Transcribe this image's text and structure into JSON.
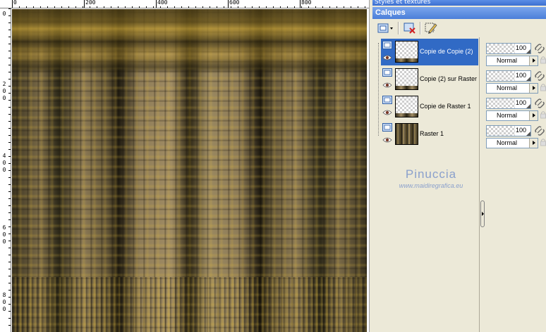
{
  "panel": {
    "styles_title": "Styles et textures",
    "layers_title": "Calques"
  },
  "ruler": {
    "top_labels": [
      "0",
      "200",
      "400",
      "600",
      "800"
    ],
    "left_labels": [
      "0",
      "2",
      "0",
      "0",
      "4",
      "0",
      "0",
      "6",
      "0",
      "0",
      "8",
      "0",
      "0"
    ]
  },
  "layers": [
    {
      "name": "Copie de Copie (2)",
      "selected": true,
      "thumb": "checker-strip",
      "opacity": "100",
      "blend": "Normal"
    },
    {
      "name": "Copie (2) sur Raster",
      "selected": false,
      "thumb": "checker-strip",
      "opacity": "100",
      "blend": "Normal"
    },
    {
      "name": "Copie de Raster 1",
      "selected": false,
      "thumb": "checker-strip",
      "opacity": "100",
      "blend": "Normal"
    },
    {
      "name": "Raster 1",
      "selected": false,
      "thumb": "full",
      "opacity": "100",
      "blend": "Normal"
    }
  ],
  "watermark": {
    "title": "Pinuccia",
    "url": "www.maidiregrafica.eu"
  },
  "colors": {
    "selection": "#316ac5",
    "title_bar": "#4b7fd9",
    "panel_bg": "#ece9d8",
    "watermark": "#8aa0cc"
  },
  "icons": {
    "new_layer": "new-layer-icon",
    "delete_layer": "delete-layer-icon",
    "edit_layer": "edit-layer-icon",
    "visibility": "eye-icon",
    "link": "link-icon",
    "lock": "lock-icon"
  }
}
